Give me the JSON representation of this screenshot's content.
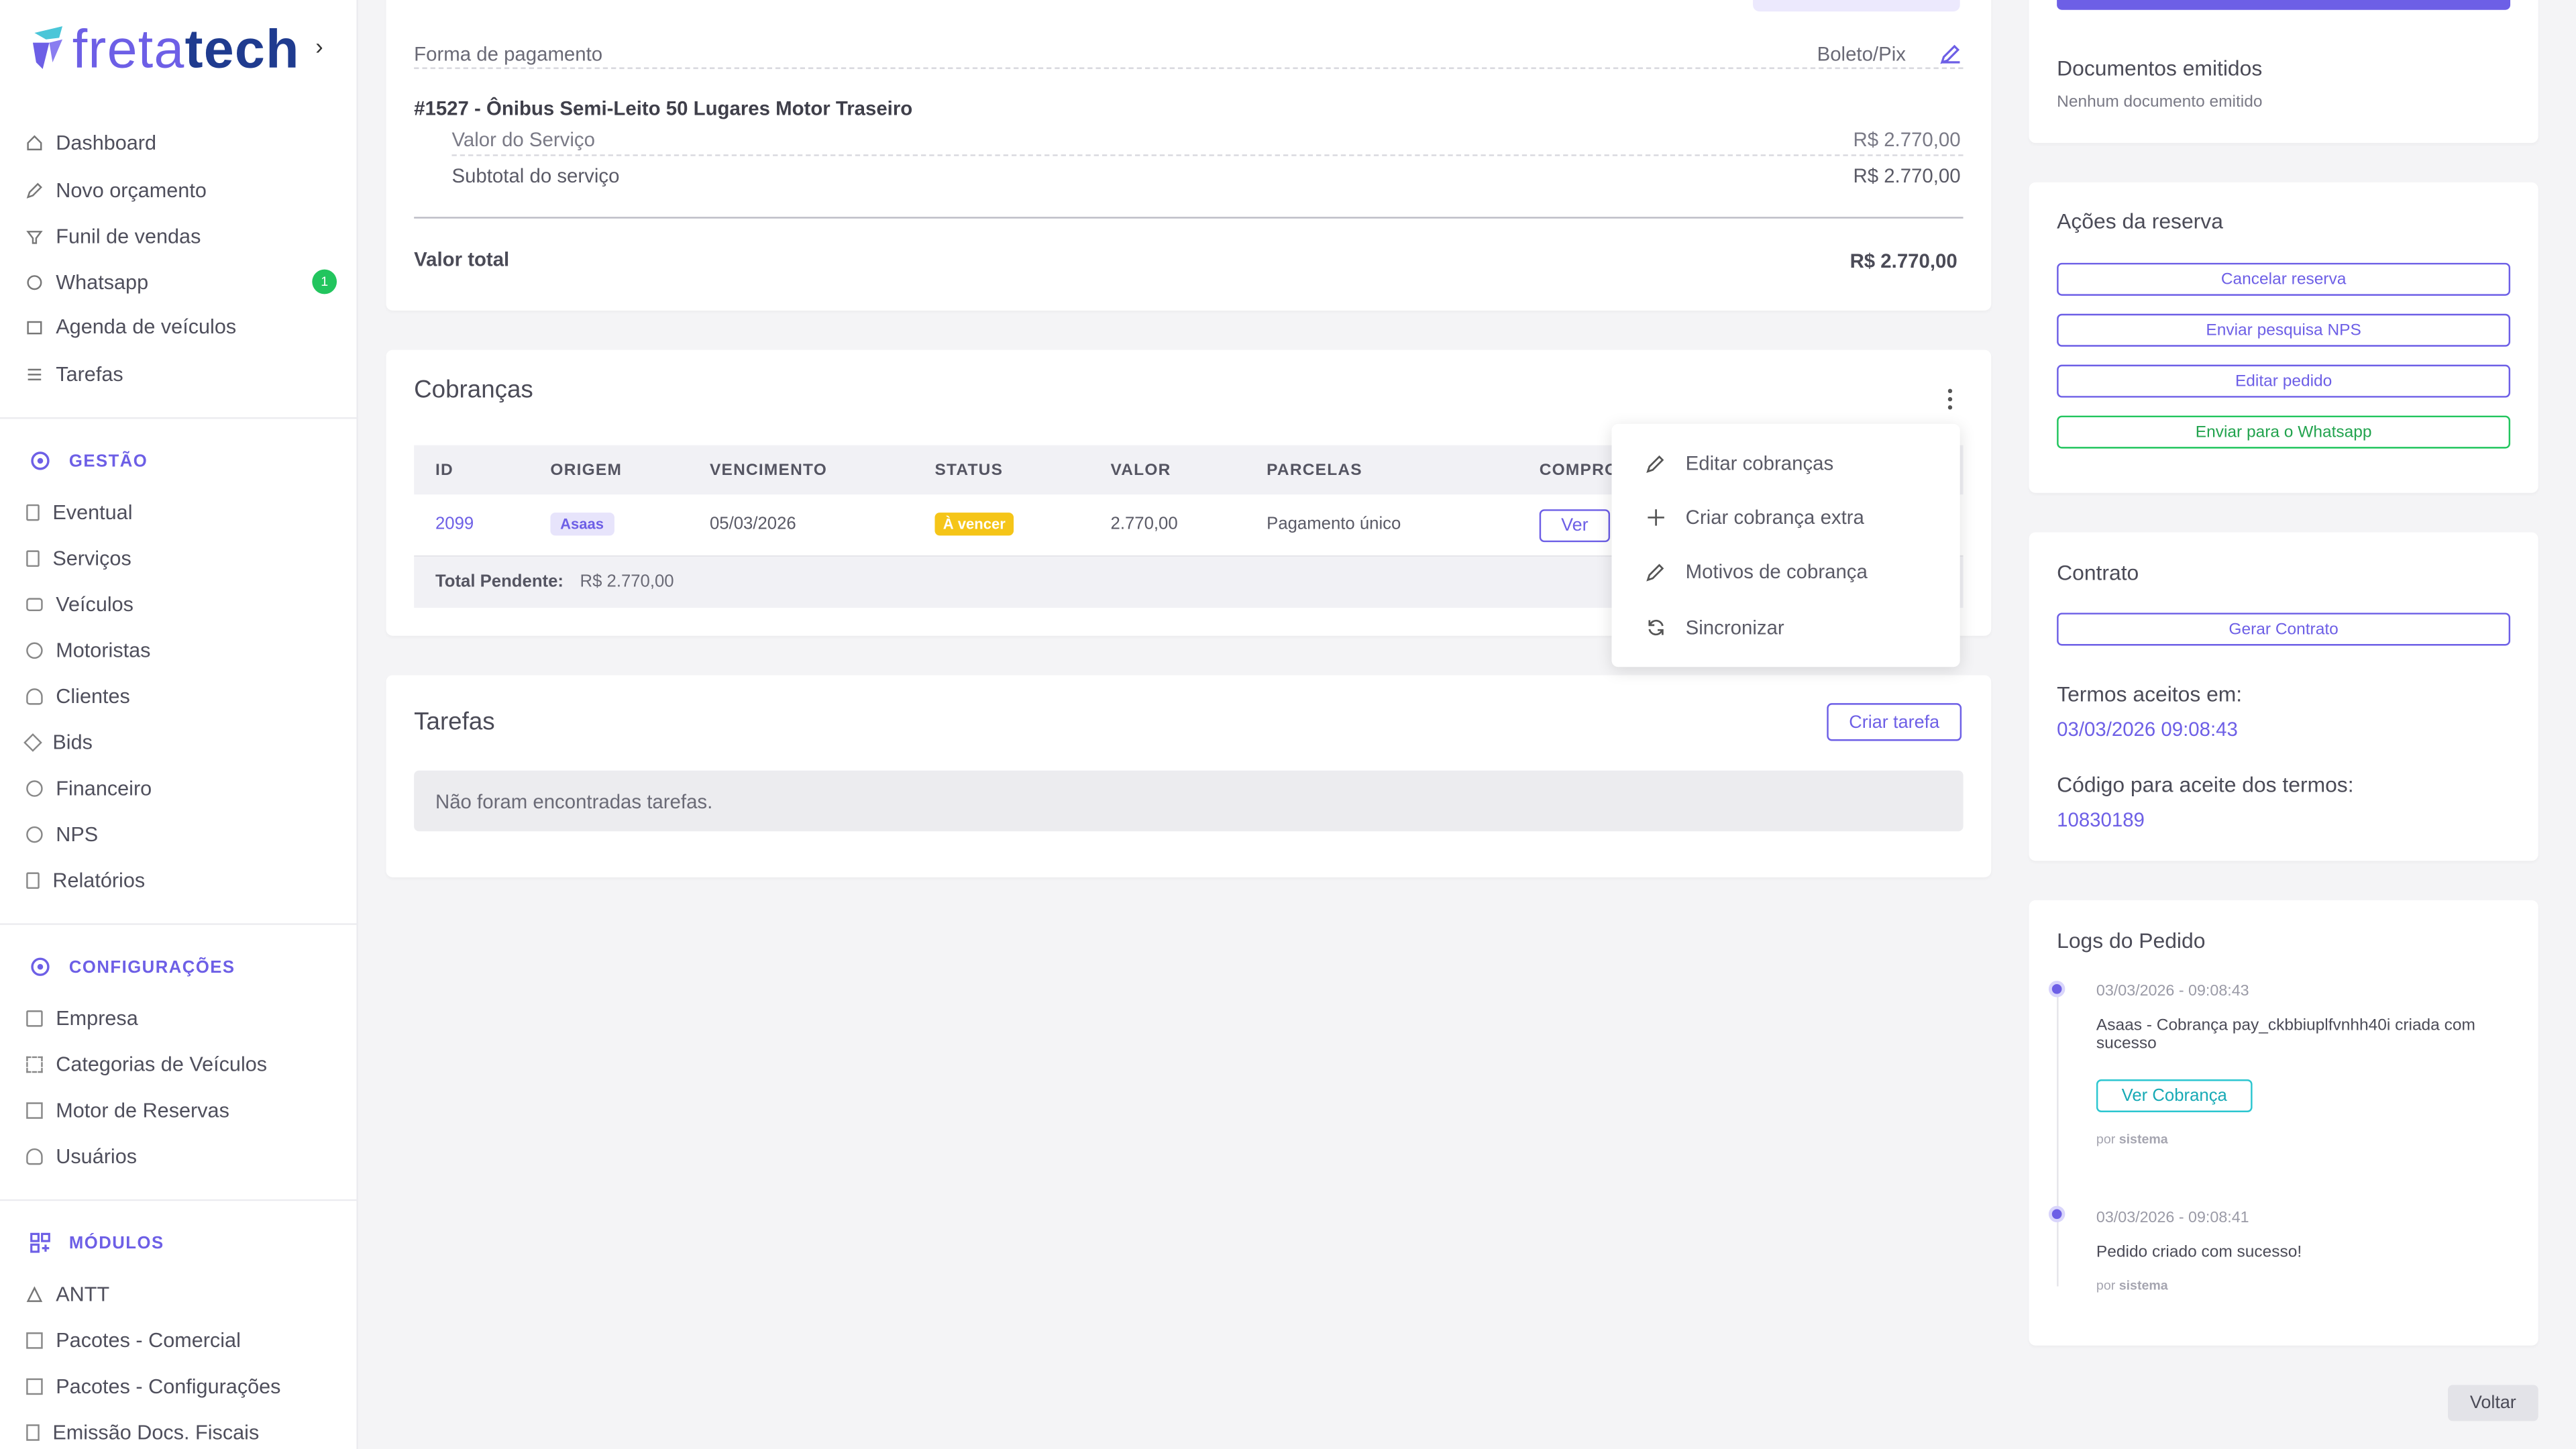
{
  "brand": {
    "name_part1": "freta",
    "name_part2": "tech"
  },
  "sidebar": {
    "main": [
      {
        "label": "Dashboard",
        "icon": "home-icon"
      },
      {
        "label": "Novo orçamento",
        "icon": "edit-icon"
      },
      {
        "label": "Funil de vendas",
        "icon": "funnel-icon"
      },
      {
        "label": "Whatsapp",
        "icon": "whatsapp-icon",
        "badge": "1"
      },
      {
        "label": "Agenda de veículos",
        "icon": "calendar-icon"
      },
      {
        "label": "Tarefas",
        "icon": "list-icon"
      }
    ],
    "gestao_title": "GESTÃO",
    "gestao": [
      {
        "label": "Eventual"
      },
      {
        "label": "Serviços"
      },
      {
        "label": "Veículos"
      },
      {
        "label": "Motoristas"
      },
      {
        "label": "Clientes"
      },
      {
        "label": "Bids"
      },
      {
        "label": "Financeiro"
      },
      {
        "label": "NPS"
      },
      {
        "label": "Relatórios"
      }
    ],
    "config_title": "CONFIGURAÇÕES",
    "config": [
      {
        "label": "Empresa"
      },
      {
        "label": "Categorias de Veículos"
      },
      {
        "label": "Motor de Reservas"
      },
      {
        "label": "Usuários"
      }
    ],
    "modulos_title": "MÓDULOS",
    "modulos": [
      {
        "label": "ANTT"
      },
      {
        "label": "Pacotes - Comercial"
      },
      {
        "label": "Pacotes - Configurações"
      },
      {
        "label": "Emissão Docs. Fiscais"
      }
    ]
  },
  "summary": {
    "payment_label": "Forma de pagamento",
    "payment_value": "Boleto/Pix",
    "item_title": "#1527 - Ônibus Semi-Leito 50 Lugares Motor Traseiro",
    "service_value_label": "Valor do Serviço",
    "service_value": "R$ 2.770,00",
    "subtotal_label": "Subtotal do serviço",
    "subtotal_value": "R$ 2.770,00",
    "total_label": "Valor total",
    "total_value": "R$ 2.770,00"
  },
  "cobrancas": {
    "title": "Cobranças",
    "columns": [
      "ID",
      "ORIGEM",
      "VENCIMENTO",
      "STATUS",
      "VALOR",
      "PARCELAS",
      "COMPRO"
    ],
    "row": {
      "id": "2099",
      "origem": "Asaas",
      "vencimento": "05/03/2026",
      "status": "À vencer",
      "valor": "2.770,00",
      "parcelas": "Pagamento único",
      "comprovante_btn": "Ver"
    },
    "total_label": "Total Pendente:",
    "total_value": "R$ 2.770,00",
    "menu": [
      "Editar cobranças",
      "Criar cobrança extra",
      "Motivos de cobrança",
      "Sincronizar"
    ]
  },
  "tarefas": {
    "title": "Tarefas",
    "create_btn": "Criar tarefa",
    "empty": "Não foram encontradas tarefas."
  },
  "right": {
    "docs_title": "Documentos emitidos",
    "docs_empty": "Nenhum documento emitido",
    "acoes_title": "Ações da reserva",
    "acoes": [
      "Cancelar reserva",
      "Enviar pesquisa NPS",
      "Editar pedido",
      "Enviar para o Whatsapp"
    ],
    "contrato_title": "Contrato",
    "gerar_contrato": "Gerar Contrato",
    "termos_label": "Termos aceitos em:",
    "termos_value": "03/03/2026 09:08:43",
    "codigo_label": "Código para aceite dos termos:",
    "codigo_value": "10830189",
    "logs_title": "Logs do Pedido",
    "logs": [
      {
        "time": "03/03/2026 - 09:08:43",
        "text": "Asaas - Cobrança pay_ckbbiuplfvnhh40i criada com sucesso",
        "btn": "Ver Cobrança",
        "by_prefix": "por",
        "by": "sistema"
      },
      {
        "time": "03/03/2026 - 09:08:41",
        "text": "Pedido criado com sucesso!",
        "by_prefix": "por",
        "by": "sistema"
      }
    ],
    "voltar": "Voltar"
  },
  "colors": {
    "accent": "#6d5fe6",
    "green": "#22c55e",
    "warning": "#f5c518",
    "navy": "#1f3b8f"
  }
}
